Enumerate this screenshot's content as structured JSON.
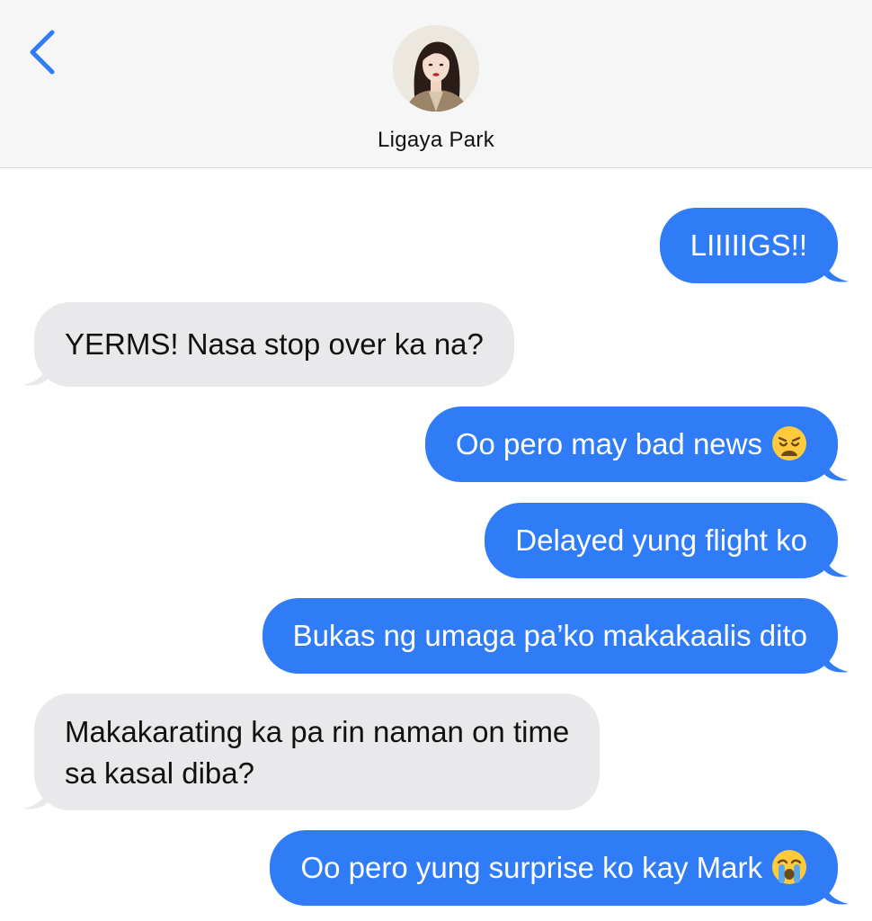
{
  "header": {
    "contact_name": "Ligaya Park",
    "back_icon": "chevron-left-icon",
    "accent_color": "#2f7cf6"
  },
  "messages": [
    {
      "direction": "outgoing",
      "text": "LIIIIIGS!!"
    },
    {
      "direction": "incoming",
      "text": "YERMS! Nasa stop over ka na?"
    },
    {
      "direction": "outgoing",
      "text": "Oo pero may bad news",
      "emoji": "weary-face"
    },
    {
      "direction": "outgoing",
      "text": "Delayed yung flight ko"
    },
    {
      "direction": "outgoing",
      "text": "Bukas ng umaga pa’ko makakaalis dito"
    },
    {
      "direction": "incoming",
      "lines": [
        "Makakarating ka pa rin naman on time",
        "sa kasal diba?"
      ]
    },
    {
      "direction": "outgoing",
      "text": "Oo pero yung surprise ko kay Mark",
      "emoji": "loudly-crying-face"
    }
  ],
  "colors": {
    "outgoing_bubble": "#2f7cf6",
    "incoming_bubble": "#e9e9eb",
    "header_bg": "#f6f6f6"
  }
}
